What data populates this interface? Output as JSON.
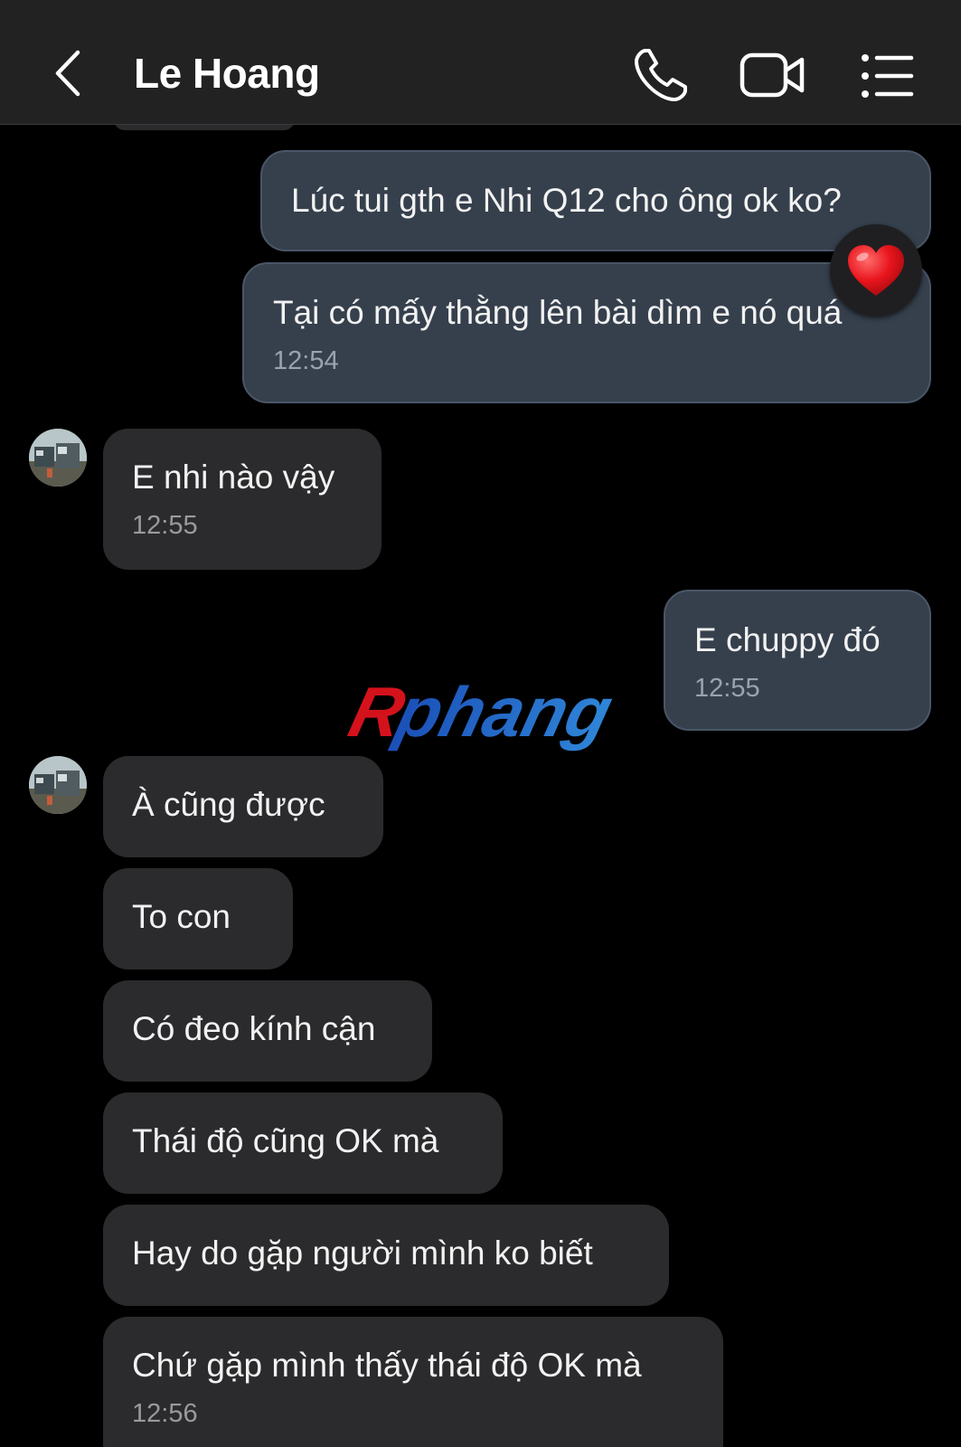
{
  "header": {
    "title": "Le Hoang",
    "back_icon": "chevron-left-icon",
    "call_icon": "phone-icon",
    "video_icon": "video-camera-icon",
    "menu_icon": "list-menu-icon"
  },
  "messages": [
    {
      "side": "out",
      "text": "Lúc tui gth e Nhi Q12 cho ông ok ko?",
      "time": ""
    },
    {
      "side": "out",
      "text": "Tại có mấy thằng lên bài dìm e nó quá",
      "time": "12:54",
      "reaction": "❤️"
    },
    {
      "side": "in",
      "text": "E nhi nào vậy",
      "time": "12:55"
    },
    {
      "side": "out",
      "text": "E chuppy đó",
      "time": "12:55"
    },
    {
      "side": "in",
      "text": "À cũng được",
      "time": ""
    },
    {
      "side": "in",
      "text": "To con",
      "time": ""
    },
    {
      "side": "in",
      "text": "Có đeo kính cận",
      "time": ""
    },
    {
      "side": "in",
      "text": "Thái độ cũng OK mà",
      "time": ""
    },
    {
      "side": "in",
      "text": "Hay do gặp người mình ko biết",
      "time": ""
    },
    {
      "side": "in",
      "text": "Chứ gặp mình thấy thái độ OK mà",
      "time": "12:56"
    }
  ],
  "watermark": "Rphang",
  "colors": {
    "background": "#000000",
    "header_bg": "#222223",
    "outgoing_bubble": "#36404d",
    "incoming_bubble": "#2b2b2d",
    "timestamp": "#8e8e93",
    "watermark_red": "#d4121c",
    "watermark_blue": "#1f63c6"
  }
}
